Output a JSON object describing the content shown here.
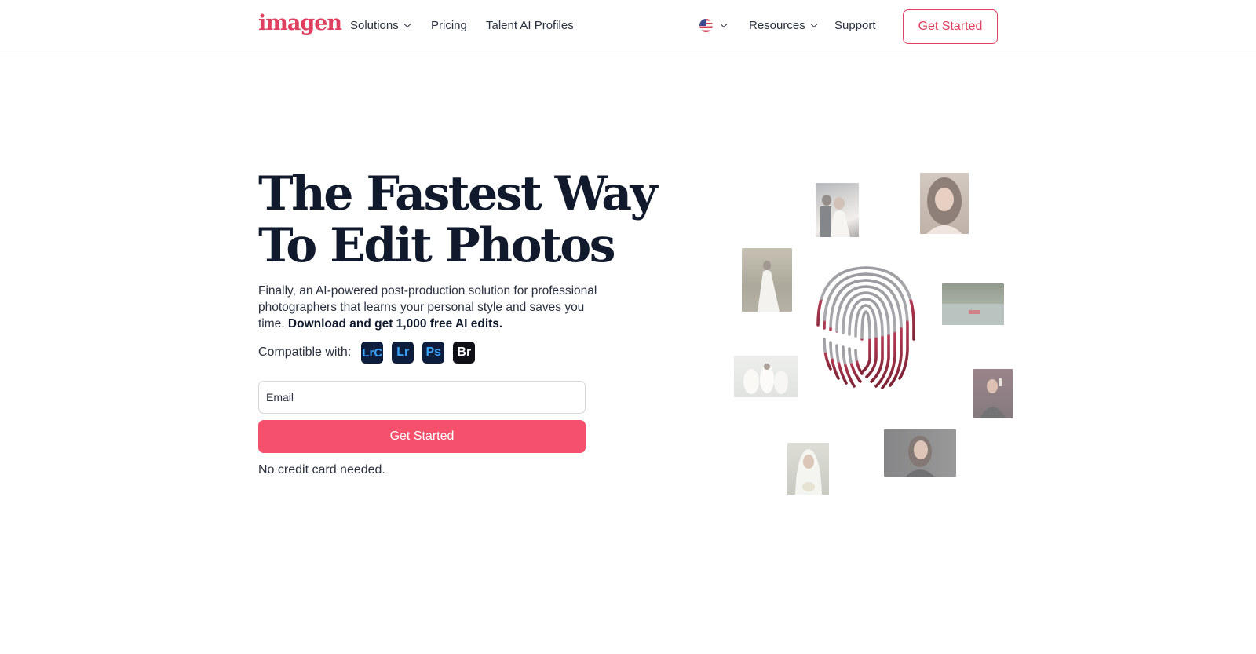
{
  "header": {
    "logo": "imagen",
    "nav": {
      "solutions": "Solutions",
      "pricing": "Pricing",
      "talent": "Talent AI Profiles",
      "resources": "Resources",
      "support": "Support"
    },
    "cta": "Get Started"
  },
  "hero": {
    "headline_line1": "The Fastest Way",
    "headline_line2": "To Edit Photos",
    "description": "Finally, an AI-powered post-production solution for professional photographers that learns your personal style and saves you time.",
    "description_bold": "Download and get 1,000 free AI edits.",
    "compatible_label": "Compatible with:",
    "apps": [
      "LrC",
      "Lr",
      "Ps",
      "Br"
    ],
    "email_placeholder": "Email",
    "cta": "Get Started",
    "note": "No credit card needed."
  },
  "colors": {
    "brand": "#e0405f",
    "cta_fill": "#f5506c",
    "headline": "#111a2c"
  }
}
